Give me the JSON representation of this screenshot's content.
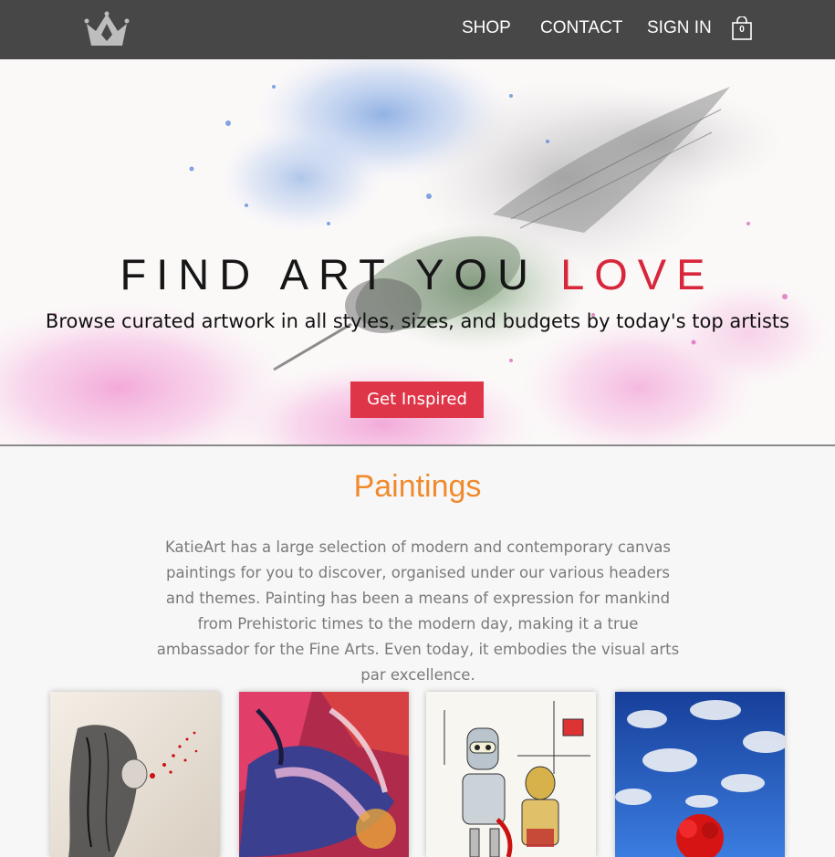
{
  "header": {
    "logo_icon": "crown-icon",
    "nav": {
      "shop": "SHOP",
      "contact": "CONTACT",
      "sign_in": "SIGN IN"
    },
    "cart_icon": "shopping-bag-icon",
    "cart_count": "0"
  },
  "hero": {
    "title_main": "FIND ART YOU ",
    "title_accent": "LOVE",
    "subtitle": "Browse curated artwork in all styles, sizes, and budgets by today's top artists",
    "cta_label": "Get Inspired"
  },
  "paintings": {
    "title": "Paintings",
    "description": "KatieArt has a large selection of modern and contemporary canvas paintings for you to discover, organised under our various headers and themes. Painting has been a means of expression for mankind from Prehistoric times to the modern day, making it a true ambassador for the Fine Arts. Even today, it embodies the visual arts par excellence."
  },
  "colors": {
    "header_bg": "#474747",
    "accent_red": "#d8273a",
    "button_red": "#df3548",
    "section_title_orange": "#f08a2c",
    "body_text_gray": "#7a7a7a"
  }
}
